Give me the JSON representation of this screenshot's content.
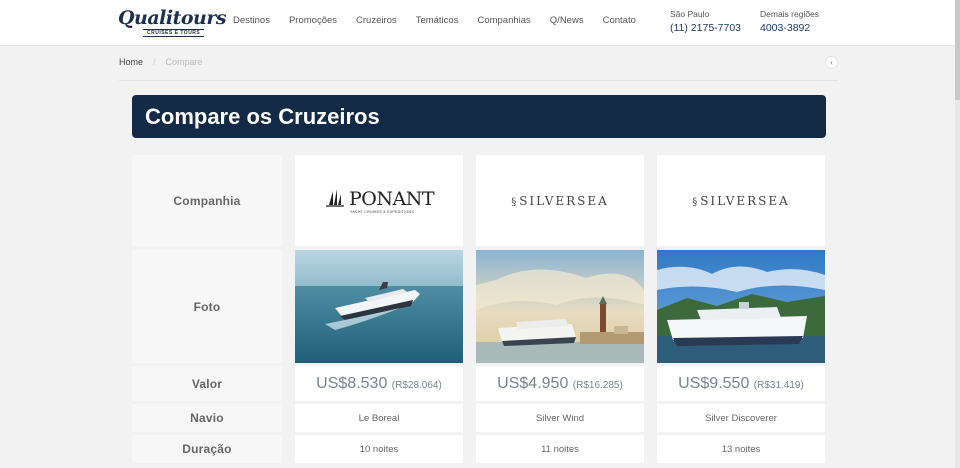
{
  "header": {
    "logo_text": "Qualitours",
    "logo_sub": "CRUISES E TOURS",
    "nav": [
      "Destinos",
      "Promoções",
      "Cruzeiros",
      "Temáticos",
      "Companhias",
      "Q/News",
      "Contato"
    ],
    "contacts": [
      {
        "city": "São Paulo",
        "phone": "(11) 2175-7703"
      },
      {
        "city": "Demais regiões",
        "phone": "4003-3892"
      }
    ]
  },
  "breadcrumb": {
    "home": "Home",
    "separator": "/",
    "current": "Compare"
  },
  "back_icon": "chevron-left-icon",
  "title": "Compare os Cruzeiros",
  "colors": {
    "banner": "#132a47",
    "phone": "#1d3a6b",
    "price": "#7a8390"
  },
  "rows": {
    "company": "Companhia",
    "photo": "Foto",
    "price": "Valor",
    "ship": "Navio",
    "duration": "Duração"
  },
  "cruises": [
    {
      "company": "PONANT",
      "company_tag": "YACHT CRUISES & EXPEDITIONS",
      "price": "US$8.530",
      "price_brl": "(R$28.064)",
      "ship": "Le Boreal",
      "duration": "10 noites"
    },
    {
      "company": "SILVERSEA",
      "price": "US$4.950",
      "price_brl": "(R$16.285)",
      "ship": "Silver Wind",
      "duration": "11 noites"
    },
    {
      "company": "SILVERSEA",
      "price": "US$9.550",
      "price_brl": "(R$31.419)",
      "ship": "Silver Discoverer",
      "duration": "13 noites"
    }
  ]
}
